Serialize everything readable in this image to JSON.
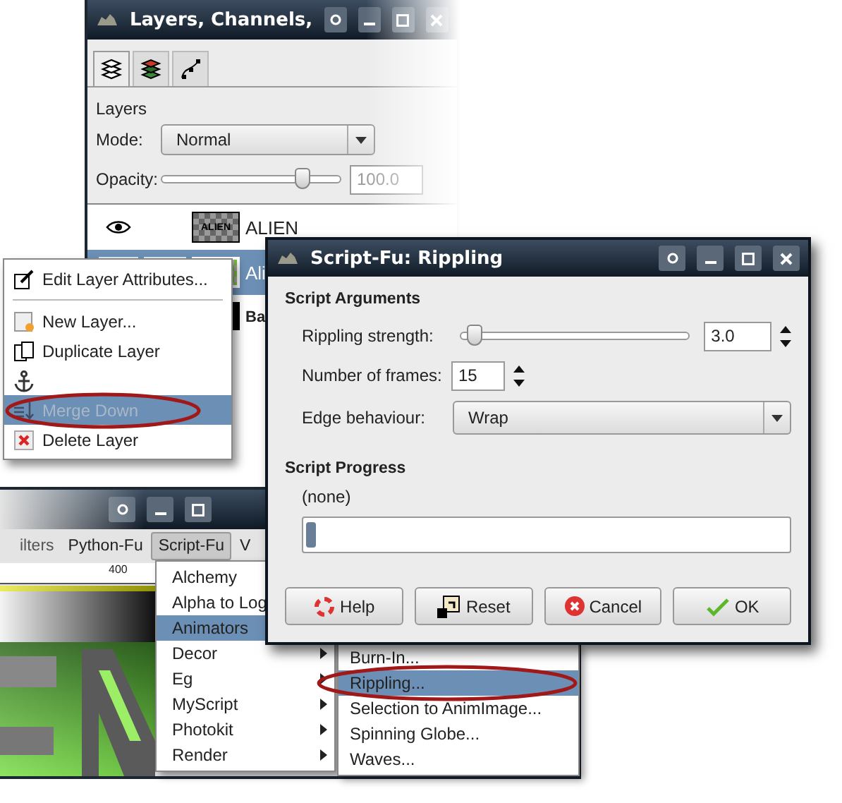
{
  "layers_window": {
    "title": "Layers, Channels,",
    "tabs": [
      {
        "kind": "layers",
        "selected": true
      },
      {
        "kind": "channels",
        "selected": false
      },
      {
        "kind": "paths",
        "selected": false
      }
    ],
    "heading": "Layers",
    "mode_label": "Mode:",
    "mode_value": "Normal",
    "opacity_label": "Opacity:",
    "opacity": {
      "level": 0.78
    },
    "opacity_value": "100.0",
    "layers": [
      {
        "name": "ALIEN",
        "kind": "text",
        "thumb_label": "ALIEN",
        "selected": false
      },
      {
        "name": "Ali",
        "kind": "green",
        "selected": true
      },
      {
        "name": "Ba",
        "kind": "black",
        "selected": false
      }
    ]
  },
  "context_menu": [
    {
      "kind": "edit",
      "label": "Edit Layer Attributes...",
      "selected": false,
      "disabled": false
    },
    {
      "kind": "separator"
    },
    {
      "kind": "new",
      "label": "New Layer...",
      "selected": false,
      "disabled": false
    },
    {
      "kind": "duplicate",
      "label": "Duplicate Layer",
      "selected": false,
      "disabled": false
    },
    {
      "kind": "anchor",
      "selected": false,
      "disabled": false
    },
    {
      "kind": "merge",
      "label": "Merge Down",
      "selected": true,
      "disabled": true
    },
    {
      "kind": "delete",
      "label": "Delete Layer",
      "selected": false,
      "disabled": false
    }
  ],
  "image_window": {
    "menubar": [
      {
        "label": "ilters",
        "selected": false,
        "faded": true
      },
      {
        "label": "Python-Fu",
        "selected": false,
        "faded": false
      },
      {
        "label": "Script-Fu",
        "selected": true,
        "faded": false
      },
      {
        "label": "V",
        "selected": false,
        "faded": false
      }
    ],
    "ruler_label": "400",
    "script_fu_menu": [
      {
        "label": "Alchemy",
        "selected": false
      },
      {
        "label": "Alpha to Log",
        "selected": false
      },
      {
        "label": "Animators",
        "selected": true
      },
      {
        "label": "Decor",
        "submenu": true,
        "selected": false
      },
      {
        "label": "Eg",
        "submenu": true,
        "selected": false
      },
      {
        "label": "MyScript",
        "submenu": true,
        "selected": false
      },
      {
        "label": "Photokit",
        "submenu": true,
        "selected": false
      },
      {
        "label": "Render",
        "submenu": true,
        "selected": false
      }
    ],
    "animators_menu": [
      {
        "label": "Burn-In...",
        "selected": false
      },
      {
        "label": "Rippling...",
        "selected": true
      },
      {
        "label": "Selection to AnimImage...",
        "selected": false
      },
      {
        "label": "Spinning Globe...",
        "selected": false
      },
      {
        "label": "Waves...",
        "selected": false
      }
    ]
  },
  "dialog": {
    "title": "Script-Fu: Rippling",
    "arguments_heading": "Script Arguments",
    "strength": {
      "label": "Rippling strength:",
      "level": 0.03,
      "value": "3.0"
    },
    "frames": {
      "label": "Number of frames:",
      "value": "15"
    },
    "edge": {
      "label": "Edge behaviour:",
      "value": "Wrap"
    },
    "progress_heading": "Script Progress",
    "progress_status": "(none)",
    "progress": {
      "level": 0.02
    },
    "buttons": [
      {
        "kind": "help",
        "label": "Help"
      },
      {
        "kind": "reset",
        "label": "Reset"
      },
      {
        "kind": "cancel",
        "label": "Cancel"
      },
      {
        "kind": "ok",
        "label": "OK"
      }
    ]
  }
}
